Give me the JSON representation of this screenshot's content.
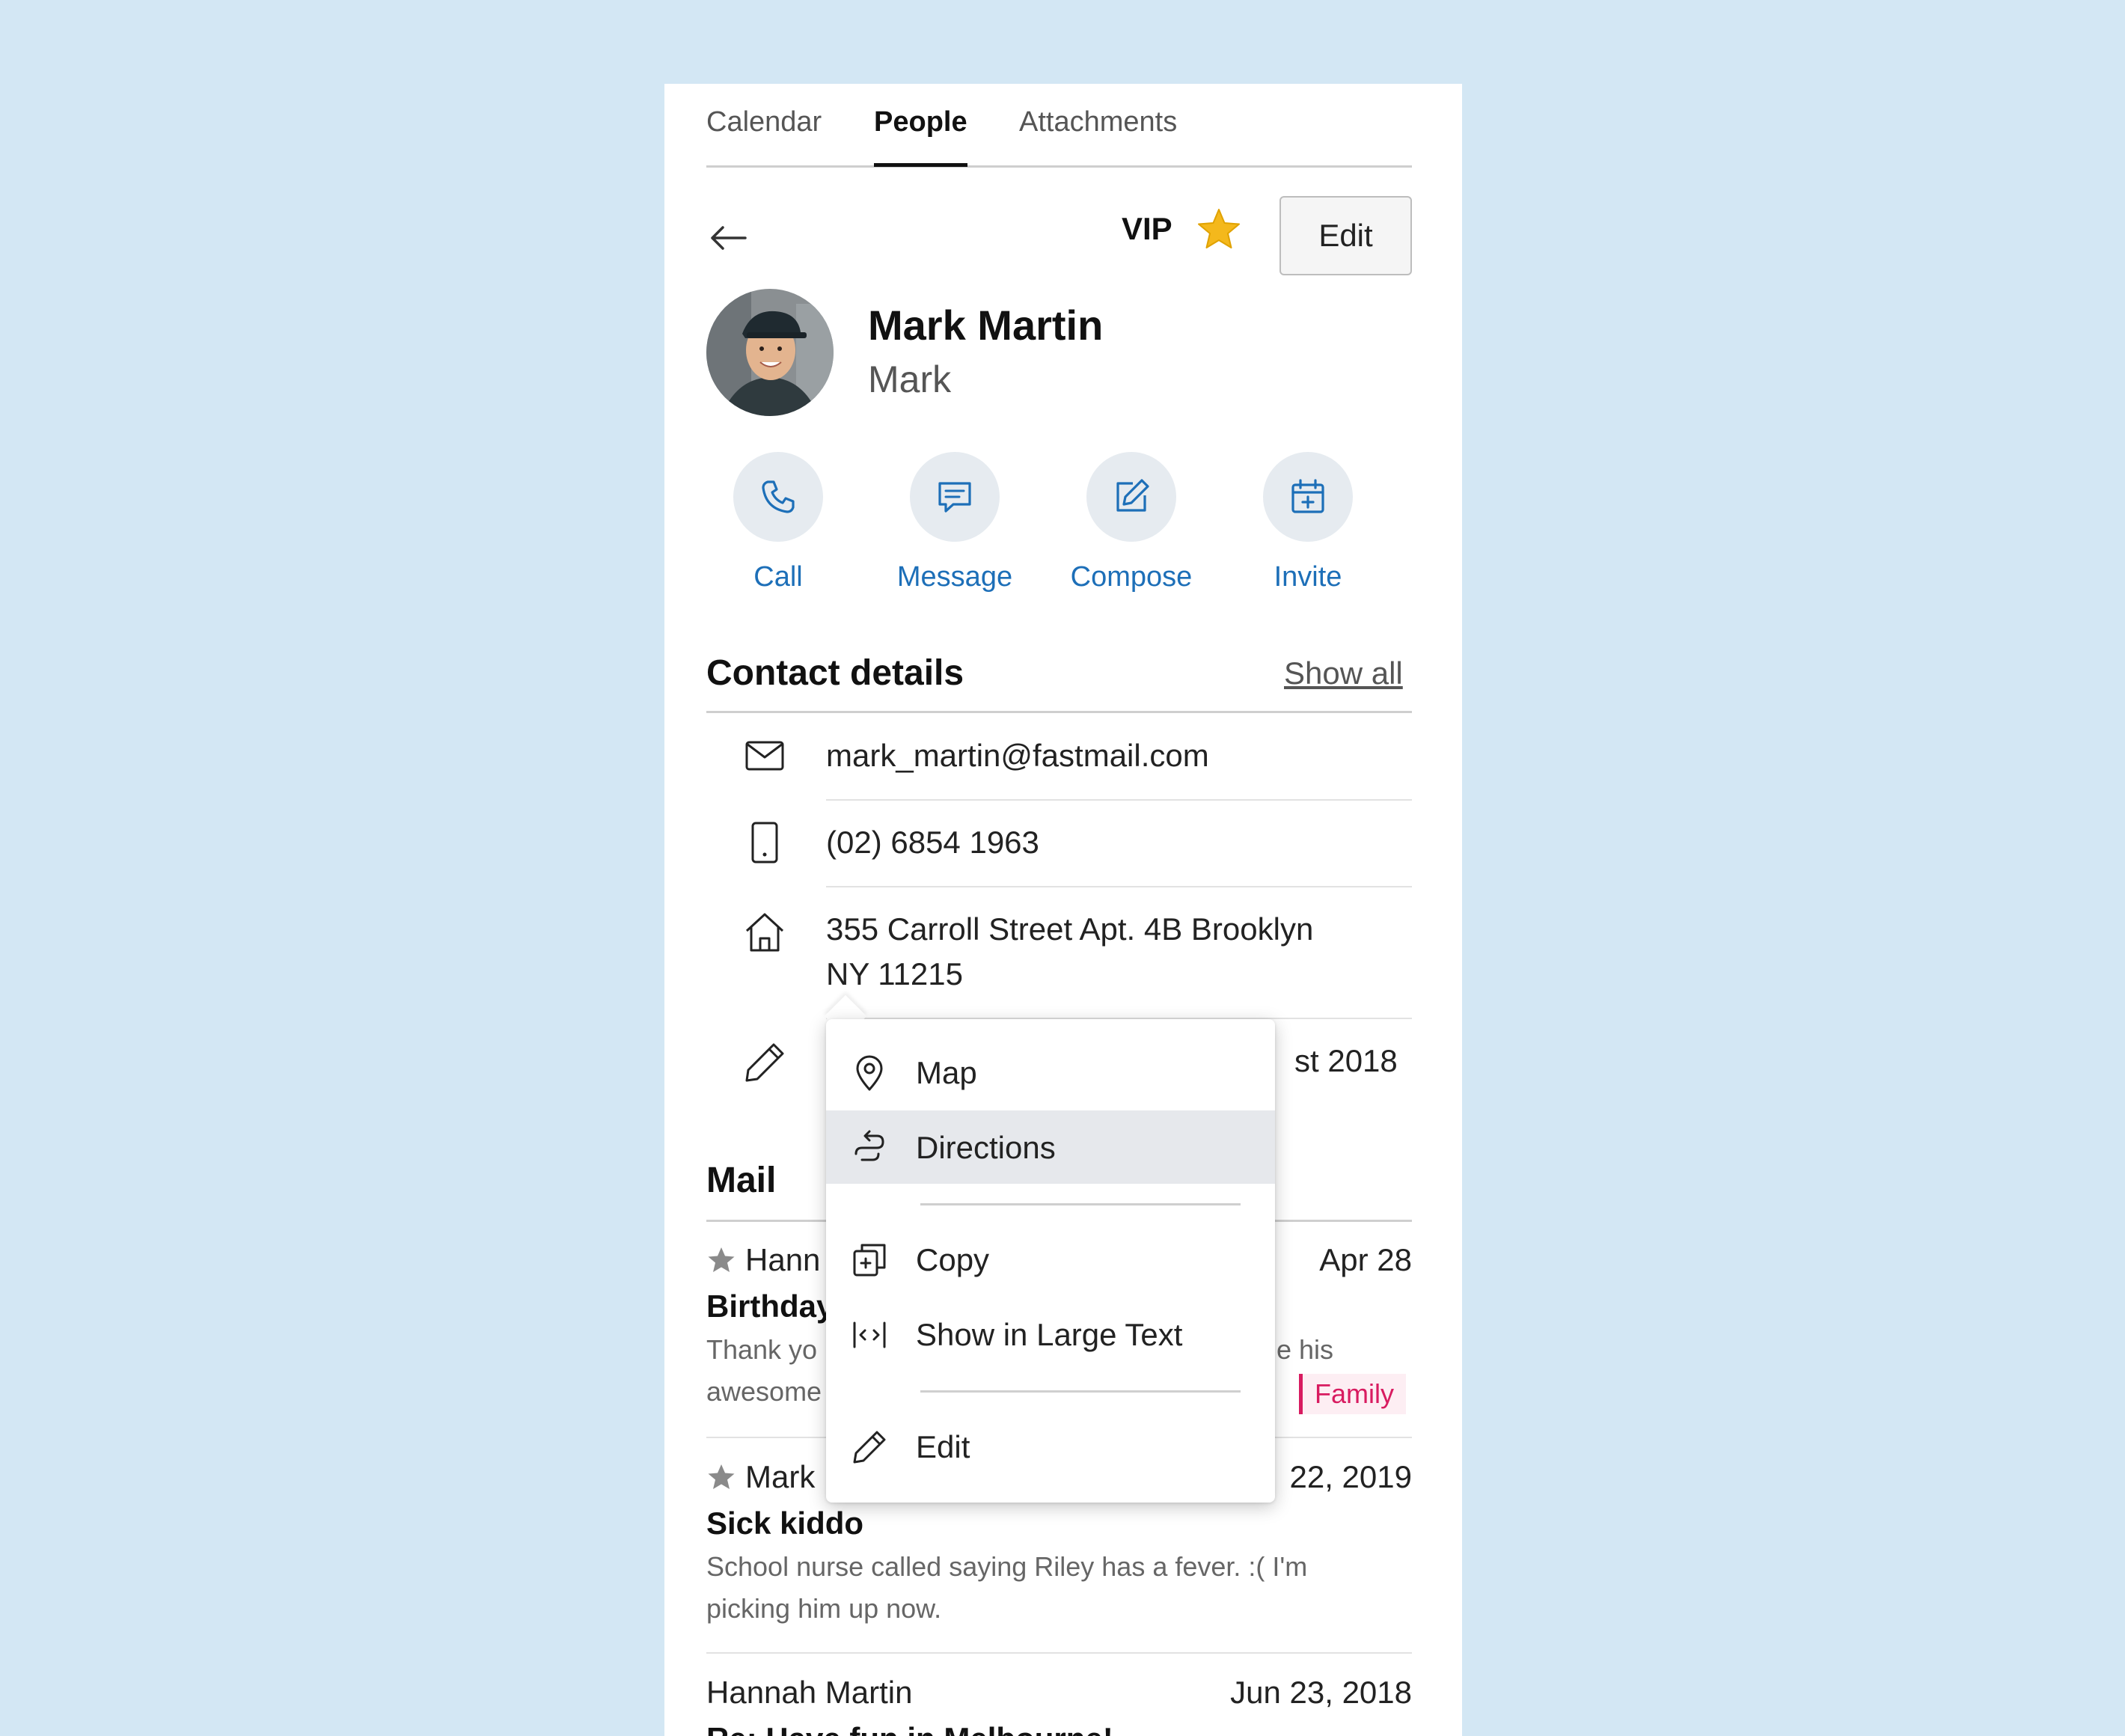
{
  "tabs": [
    "Calendar",
    "People",
    "Attachments"
  ],
  "header": {
    "vip_label": "VIP",
    "edit_label": "Edit"
  },
  "contact": {
    "name": "Mark Martin",
    "nickname": "Mark"
  },
  "actions": [
    {
      "label": "Call",
      "icon": "phone-icon"
    },
    {
      "label": "Message",
      "icon": "message-icon"
    },
    {
      "label": "Compose",
      "icon": "compose-icon"
    },
    {
      "label": "Invite",
      "icon": "calendar-add-icon"
    }
  ],
  "details": {
    "title": "Contact details",
    "show_all": "Show all",
    "email": "mark_martin@fastmail.com",
    "phone": "(02) 6854 1963",
    "address_line1": "355 Carroll Street Apt. 4B Brooklyn",
    "address_line2": "NY 11215",
    "note_partial": "st 2018"
  },
  "mail": {
    "title": "Mail",
    "items": [
      {
        "from": "Hann",
        "date": "Apr 28",
        "subject": "Birthday",
        "preview_line1": "Thank yo",
        "preview_line1_end": "e his",
        "preview_line2": "awesome",
        "tag": "Family",
        "starred": true
      },
      {
        "from": "Mark",
        "date": "22, 2019",
        "subject": "Sick kiddo",
        "preview_line1": "School nurse called saying Riley has a fever. :( I'm",
        "preview_line2": "picking him up now.",
        "starred": true
      },
      {
        "from": "Hannah Martin",
        "date": "Jun 23, 2018",
        "subject": "Re: Have fun in Melbourne!",
        "starred": false
      }
    ]
  },
  "menu": {
    "items": [
      "Map",
      "Directions",
      "Copy",
      "Show in Large Text",
      "Edit"
    ],
    "highlighted": "Directions"
  },
  "colors": {
    "background": "#d3e7f4",
    "accent": "#1d6fb8",
    "star": "#f4b81c",
    "tag": "#d81b60"
  }
}
